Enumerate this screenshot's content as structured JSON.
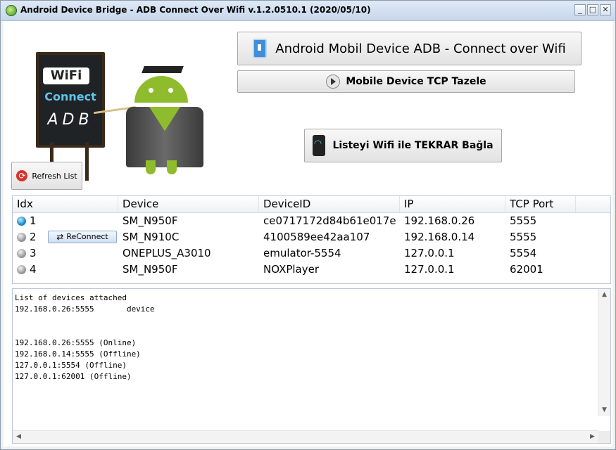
{
  "window": {
    "title": "Android Device Bridge - ADB Connect Over Wifi v.1.2.0510.1  (2020/05/10)",
    "minimize": "_",
    "maximize": "□",
    "close": "✕"
  },
  "logo": {
    "wifi": "WiFi",
    "connect": "Connect",
    "adb": "ADB"
  },
  "buttons": {
    "main": "Android Mobil Device ADB - Connect over Wifi",
    "tcp": "Mobile Device TCP Tazele",
    "retry": "Listeyi Wifi ile TEKRAR Bağla",
    "refresh": "Refresh List",
    "reconnect": "ReConnect"
  },
  "list": {
    "columns": [
      "Idx",
      "Device",
      "DeviceID",
      "IP",
      "TCP Port"
    ],
    "rows": [
      {
        "idx": "1",
        "device": "SM_N950F",
        "device_id": "ce0717172d84b61e017e",
        "ip": "192.168.0.26",
        "port": "5555",
        "status": "online"
      },
      {
        "idx": "2",
        "device": "SM_N910C",
        "device_id": "4100589ee42aa107",
        "ip": "192.168.0.14",
        "port": "5555",
        "status": "offline"
      },
      {
        "idx": "3",
        "device": "ONEPLUS_A3010",
        "device_id": "emulator-5554",
        "ip": "127.0.0.1",
        "port": "5554",
        "status": "offline"
      },
      {
        "idx": "4",
        "device": "SM_N950F",
        "device_id": "NOXPlayer",
        "ip": "127.0.0.1",
        "port": "62001",
        "status": "offline"
      }
    ]
  },
  "console": {
    "text": "List of devices attached\n192.168.0.26:5555       device\n\n\n192.168.0.26:5555 (Online)\n192.168.0.14:5555 (Offline)\n127.0.0.1:5554 (Offline)\n127.0.0.1:62001 (Offline)"
  },
  "colors": {
    "online_dot": "#1a8acb",
    "offline_dot": "#9a9a9a",
    "android_green": "#8ebc2c",
    "connect_blue": "#5fc3ea"
  },
  "icons": {
    "app": "android-icon",
    "main_button": "phone-icon",
    "tcp_button": "play-icon",
    "retry_button": "wifi-mobile-icon",
    "refresh_button": "refresh-icon",
    "reconnect_button": "reconnect-icon"
  }
}
